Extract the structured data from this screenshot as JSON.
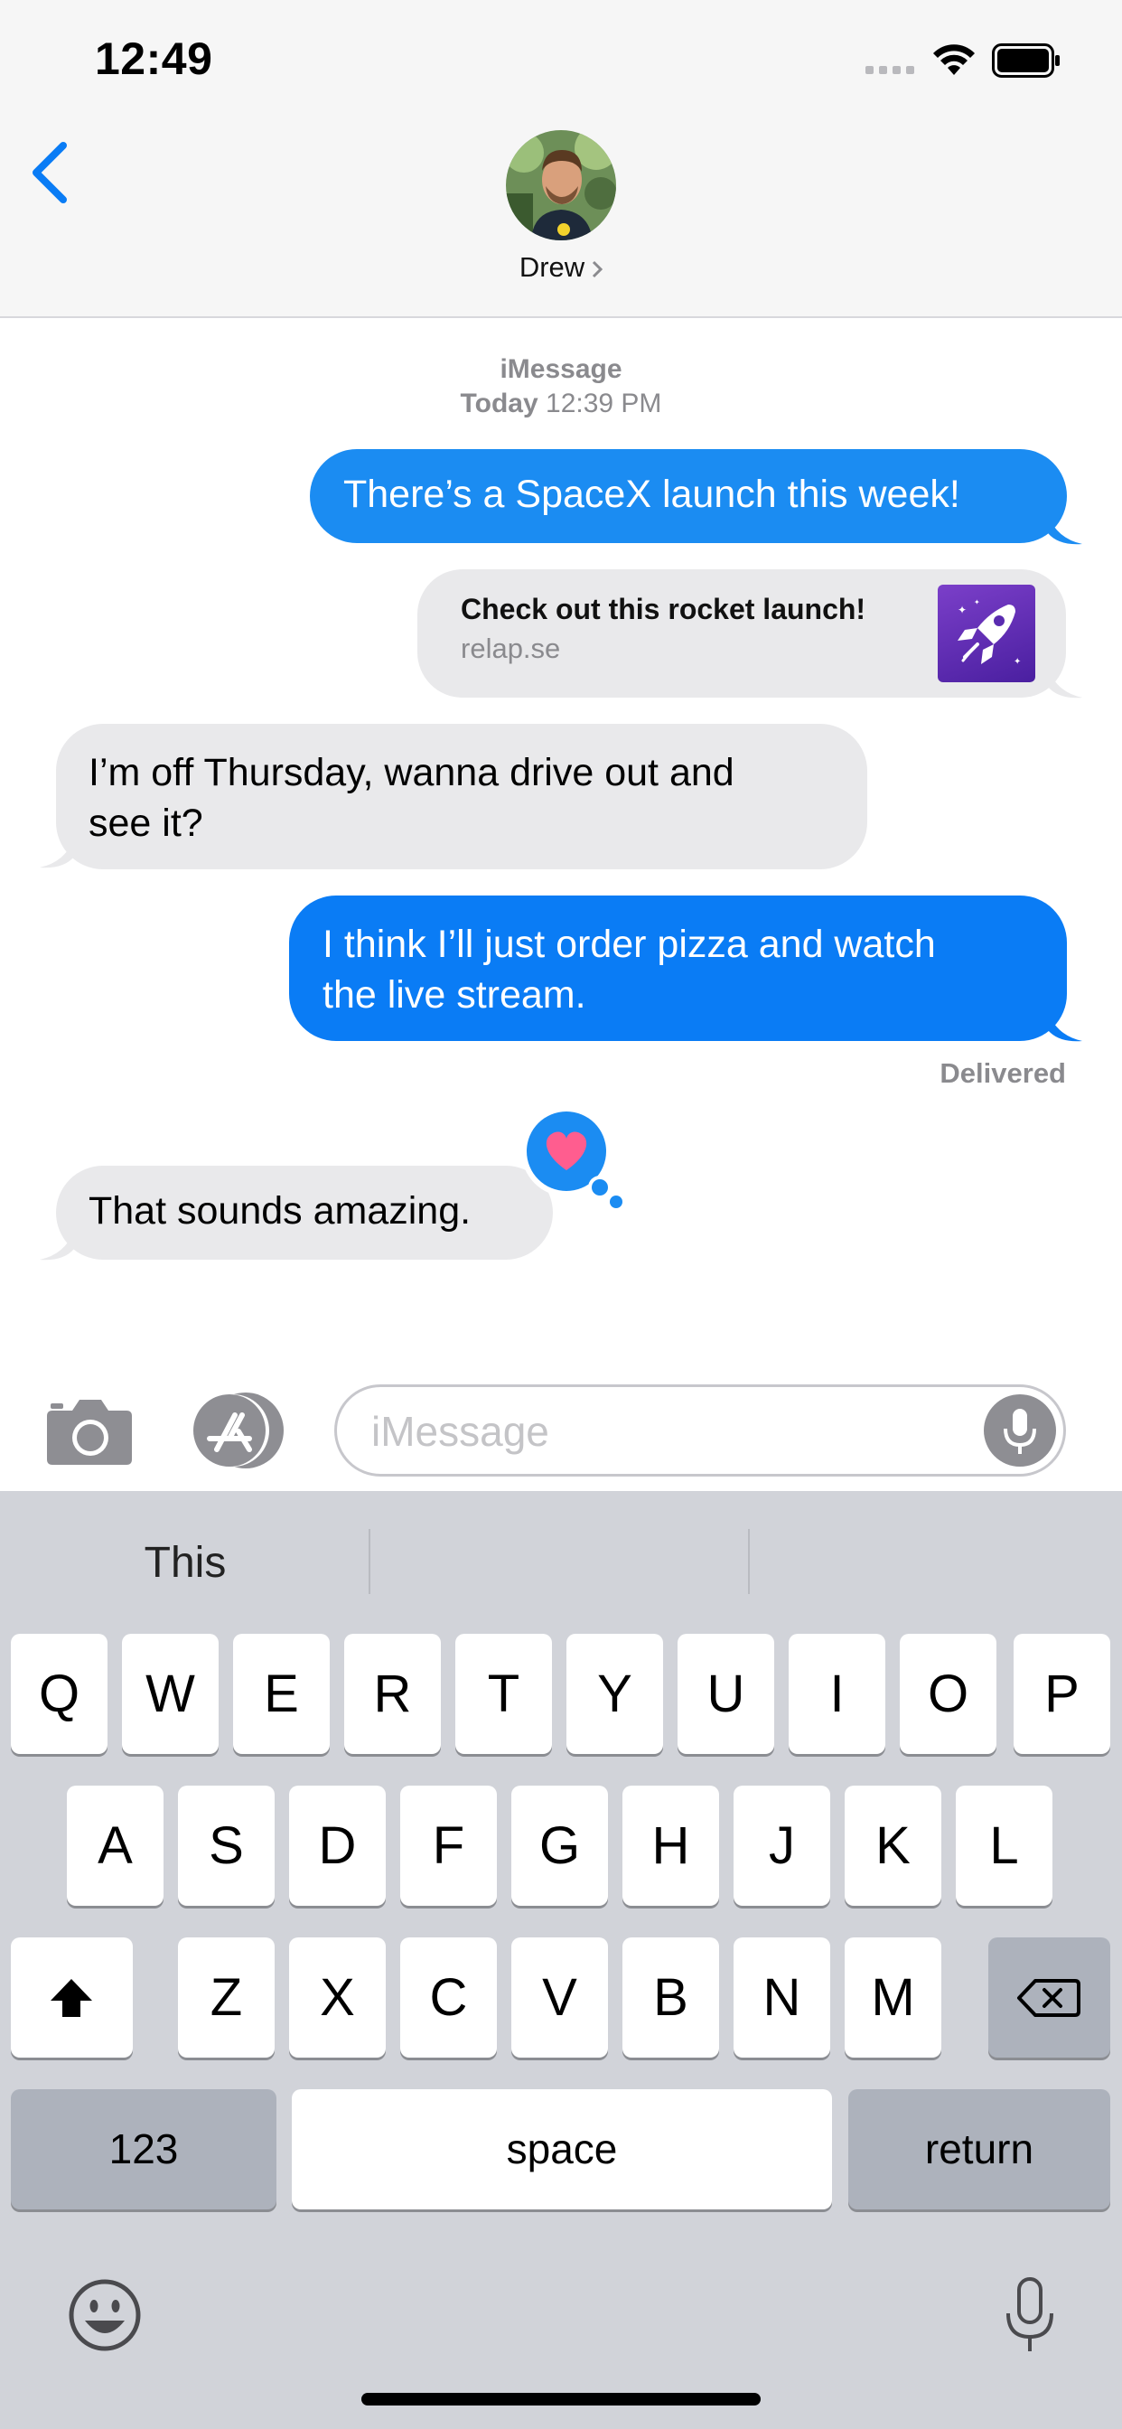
{
  "status_bar": {
    "time": "12:49"
  },
  "header": {
    "contact_name": "Drew"
  },
  "conversation": {
    "service_label": "iMessage",
    "date_day": "Today",
    "date_time": "12:39 PM",
    "messages": [
      {
        "from": "me",
        "text": "There’s a SpaceX launch this week!"
      },
      {
        "from": "me",
        "type": "link",
        "title": "Check out this rocket launch!",
        "domain": "relap.se"
      },
      {
        "from": "them",
        "line1": "I’m off Thursday, wanna drive out and",
        "line2": "see it?"
      },
      {
        "from": "me",
        "line1": "I think I’ll just order pizza and watch",
        "line2": "the live stream."
      },
      {
        "from": "them",
        "text": "That sounds amazing.",
        "reaction": "heart-icon"
      }
    ],
    "delivery_status": "Delivered"
  },
  "input_bar": {
    "placeholder": "iMessage"
  },
  "keyboard": {
    "suggestions": [
      "This",
      "",
      ""
    ],
    "row1": [
      "Q",
      "W",
      "E",
      "R",
      "T",
      "Y",
      "U",
      "I",
      "O",
      "P"
    ],
    "row2": [
      "A",
      "S",
      "D",
      "F",
      "G",
      "H",
      "J",
      "K",
      "L"
    ],
    "row3": [
      "Z",
      "X",
      "C",
      "V",
      "B",
      "N",
      "M"
    ],
    "numbers_key": "123",
    "space_key": "space",
    "return_key": "return"
  },
  "colors": {
    "sent_bubble": "#1b8cf2",
    "received_bubble": "#e9e9eb",
    "accent": "#0a7cf5",
    "heart": "#ff5d8f"
  }
}
